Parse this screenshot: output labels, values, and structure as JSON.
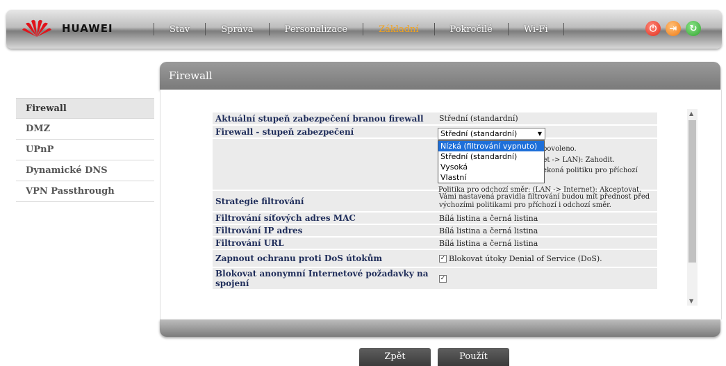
{
  "brand": "HUAWEI",
  "nav": [
    "Stav",
    "Správa",
    "Personalizace",
    "Základní",
    "Pokročilé",
    "Wi-Fi"
  ],
  "nav_active": "Základní",
  "sidebar": [
    "Firewall",
    "DMZ",
    "UPnP",
    "Dynamické DNS",
    "VPN Passthrough"
  ],
  "panel_title": "Firewall",
  "rows": {
    "current_level_label": "Aktuální stupeň zabezpečení branou firewall",
    "current_level_value": "Střední (standardní)",
    "level_label": "Firewall - stupeň zabezpečení",
    "level_selected": "Střední (standardní)",
    "desc1": "povoleno.",
    "desc2": "net -> LAN): Zahodit.",
    "desc3": "překoná politiku pro příchozí",
    "desc4": "Politika pro odchozí směr: (LAN -> Internet): Akceptovat.",
    "strategy_label": "Strategie filtrování",
    "strategy_value": "Vámi nastavená pravidla filtrování budou mít přednost před výchozími politikami pro příchozí i odchozí směr.",
    "mac_label": "Filtrování síťových adres MAC",
    "mac_value": "Bílá listina a černá listina",
    "ip_label": "Filtrování IP adres",
    "ip_value": "Bílá listina a černá listina",
    "url_label": "Filtrování URL",
    "url_value": "Bílá listina a černá listina",
    "dos_label": "Zapnout ochranu proti DoS útokům",
    "dos_value": "Blokovat útoky Denial of Service (DoS).",
    "anon_label": "Blokovat anonymní Internetové požadavky na spojení"
  },
  "dropdown_options": [
    "Nízká (filtrování vypnuto)",
    "Střední (standardní)",
    "Vysoká",
    "Vlastní"
  ],
  "buttons": {
    "back": "Zpět",
    "apply": "Použít"
  },
  "colors": {
    "accent": "#f2a31e",
    "selection": "#1e6fd9"
  }
}
